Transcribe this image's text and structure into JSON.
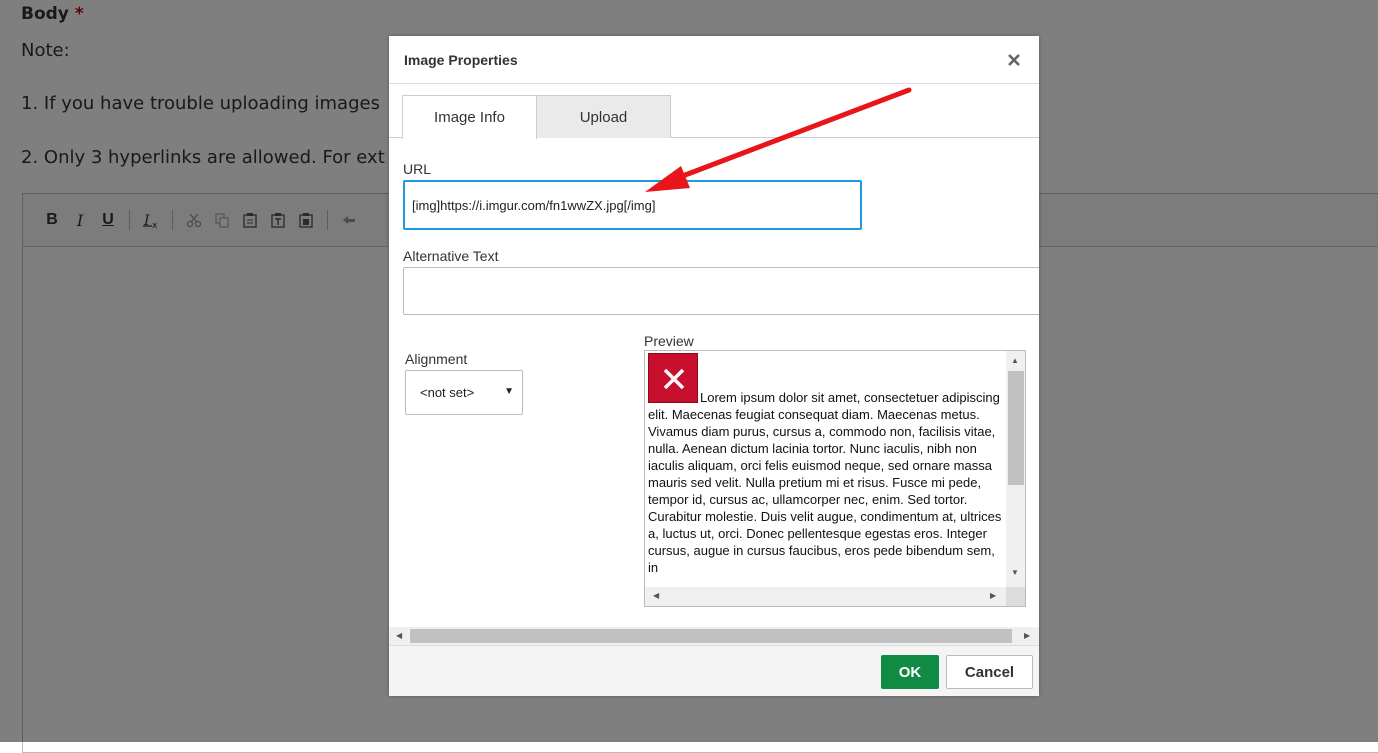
{
  "background": {
    "body_label": "Body",
    "required_mark": "*",
    "note": "Note:",
    "line1": "1. If you have trouble uploading images",
    "line2": "2. Only 3 hyperlinks are allowed. For ext",
    "toolbar": {
      "bold": "B",
      "italic": "I",
      "underline": "U"
    }
  },
  "dialog": {
    "title": "Image Properties",
    "tabs": [
      {
        "label": "Image Info",
        "active": true
      },
      {
        "label": "Upload",
        "active": false
      }
    ],
    "url_label": "URL",
    "url_value": "[img]https://i.imgur.com/fn1wwZX.jpg[/img]",
    "alt_label": "Alternative Text",
    "alt_value": "",
    "alignment_label": "Alignment",
    "alignment_value": "<not set>",
    "preview_label": "Preview",
    "preview_text": "Lorem ipsum dolor sit amet, consectetuer adipiscing elit. Maecenas feugiat consequat diam. Maecenas metus. Vivamus diam purus, cursus a, commodo non, facilisis vitae, nulla. Aenean dictum lacinia tortor. Nunc iaculis, nibh non iaculis aliquam, orci felis euismod neque, sed ornare massa mauris sed velit. Nulla pretium mi et risus. Fusce mi pede, tempor id, cursus ac, ullamcorper nec, enim. Sed tortor. Curabitur molestie. Duis velit augue, condimentum at, ultrices a, luctus ut, orci. Donec pellentesque egestas eros. Integer cursus, augue in cursus faucibus, eros pede bibendum sem, in",
    "ok_label": "OK",
    "cancel_label": "Cancel"
  },
  "colors": {
    "accent": "#1e9be0",
    "ok": "#0f8b43",
    "annotation_arrow": "#e8151b"
  },
  "icons": [
    "close-icon",
    "broken-image-icon",
    "cut-icon",
    "copy-icon",
    "paste-icon",
    "undo-icon"
  ]
}
